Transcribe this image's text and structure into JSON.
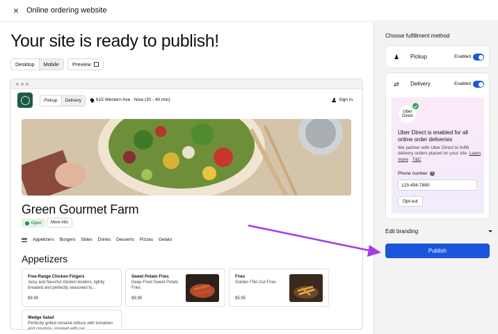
{
  "window": {
    "title": "Online ordering website",
    "close_icon": "close-icon"
  },
  "main": {
    "heading": "Your site is ready to publish!",
    "view_tabs": [
      "Desktop",
      "Mobile"
    ],
    "active_view": "Mobile",
    "preview_label": "Preview"
  },
  "site": {
    "mode_tabs": [
      "Pickup",
      "Delivery"
    ],
    "active_mode": "Delivery",
    "address": "615 Western Ave · Now (30 - 40 min)",
    "sign_in": "Sign in",
    "restaurant_name": "Green Gourmet Farm",
    "status": "Open",
    "more_info": "More info",
    "menu_nav": [
      "Appetizers",
      "Burgers",
      "Sides",
      "Drinks",
      "Desserts",
      "Pizzas",
      "Gelato"
    ],
    "section_title": "Appetizers",
    "items": [
      {
        "name": "Free-Range Chicken Fingers",
        "description": "Juicy and flavorful chicken tenders, lightly breaded and perfectly seasoned to...",
        "price": "$9.99",
        "has_image": false
      },
      {
        "name": "Sweet Potato Fries",
        "description": "Deep-Fried Sweet Potato Fries",
        "price": "$9.99",
        "has_image": true
      },
      {
        "name": "Fries",
        "description": "Golden Thin-Cut Fries",
        "price": "$5.95",
        "has_image": true
      },
      {
        "name": "Wedge Salad",
        "description": "Perfectly grilled romaine lettuce with tomatoes and croutons. Inspired with our...",
        "price": "",
        "has_image": false
      }
    ]
  },
  "sidebar": {
    "section_label": "Choose fulfillment method",
    "methods": [
      {
        "name": "Pickup",
        "state": "Enabled",
        "enabled": true,
        "icon": "pickup-icon"
      },
      {
        "name": "Delivery",
        "state": "Enabled",
        "enabled": true,
        "icon": "delivery-icon"
      }
    ],
    "uber": {
      "logo_line1": "Uber",
      "logo_line2": "Direct",
      "title": "Uber Direct is enabled for all online order deliveries",
      "desc": "We partner with Uber Direct to fulfill delivery orders placed on your site.",
      "learn_more": "Learn more",
      "separator": "·",
      "tc": "T&C",
      "phone_label": "Phone number",
      "help_glyph": "?",
      "phone_value": "123-456-7890",
      "optout_label": "Opt-out"
    },
    "edit_branding": "Edit branding",
    "publish_label": "Publish"
  },
  "colors": {
    "accent": "#1a56db",
    "open_green": "#2f8a46",
    "annotation_arrow": "#a53be8"
  }
}
